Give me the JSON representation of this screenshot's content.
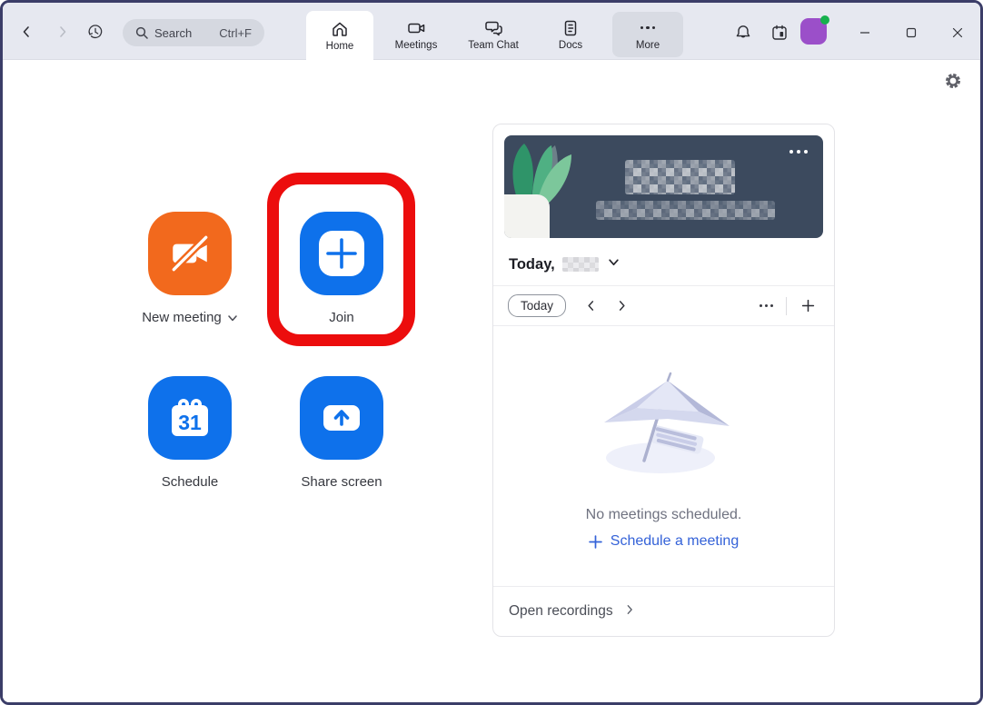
{
  "topbar": {
    "search": {
      "placeholder": "Search",
      "shortcut": "Ctrl+F"
    },
    "tabs": [
      {
        "label": "Home",
        "active": true
      },
      {
        "label": "Meetings",
        "active": false
      },
      {
        "label": "Team Chat",
        "active": false
      },
      {
        "label": "Docs",
        "active": false
      },
      {
        "label": "More",
        "active": false
      }
    ]
  },
  "launcher": {
    "highlight_color": "#ec0d0d",
    "buttons": [
      {
        "label": "New meeting",
        "color": "#f2691d",
        "icon": "video-off-icon",
        "has_dropdown": true
      },
      {
        "label": "Join",
        "color": "#0e71eb",
        "icon": "plus-icon",
        "highlighted": true
      },
      {
        "label": "Schedule",
        "color": "#0e71eb",
        "icon": "calendar-icon",
        "calendar_day": "31"
      },
      {
        "label": "Share screen",
        "color": "#0e71eb",
        "icon": "share-screen-icon"
      }
    ]
  },
  "meetings_card": {
    "banner": {
      "background_color": "#3c4a5e",
      "time_redacted": true
    },
    "date_row": {
      "prefix": "Today,"
    },
    "toolbar": {
      "today_button": "Today"
    },
    "empty_state": {
      "message": "No meetings scheduled.",
      "action": "Schedule a meeting"
    },
    "footer": {
      "label": "Open recordings"
    }
  },
  "colors": {
    "accent_blue": "#0e71eb",
    "orange": "#f2691d",
    "link_blue": "#3462d8",
    "window_border": "#3b3d68",
    "topbar_bg": "#e6e8f0"
  }
}
